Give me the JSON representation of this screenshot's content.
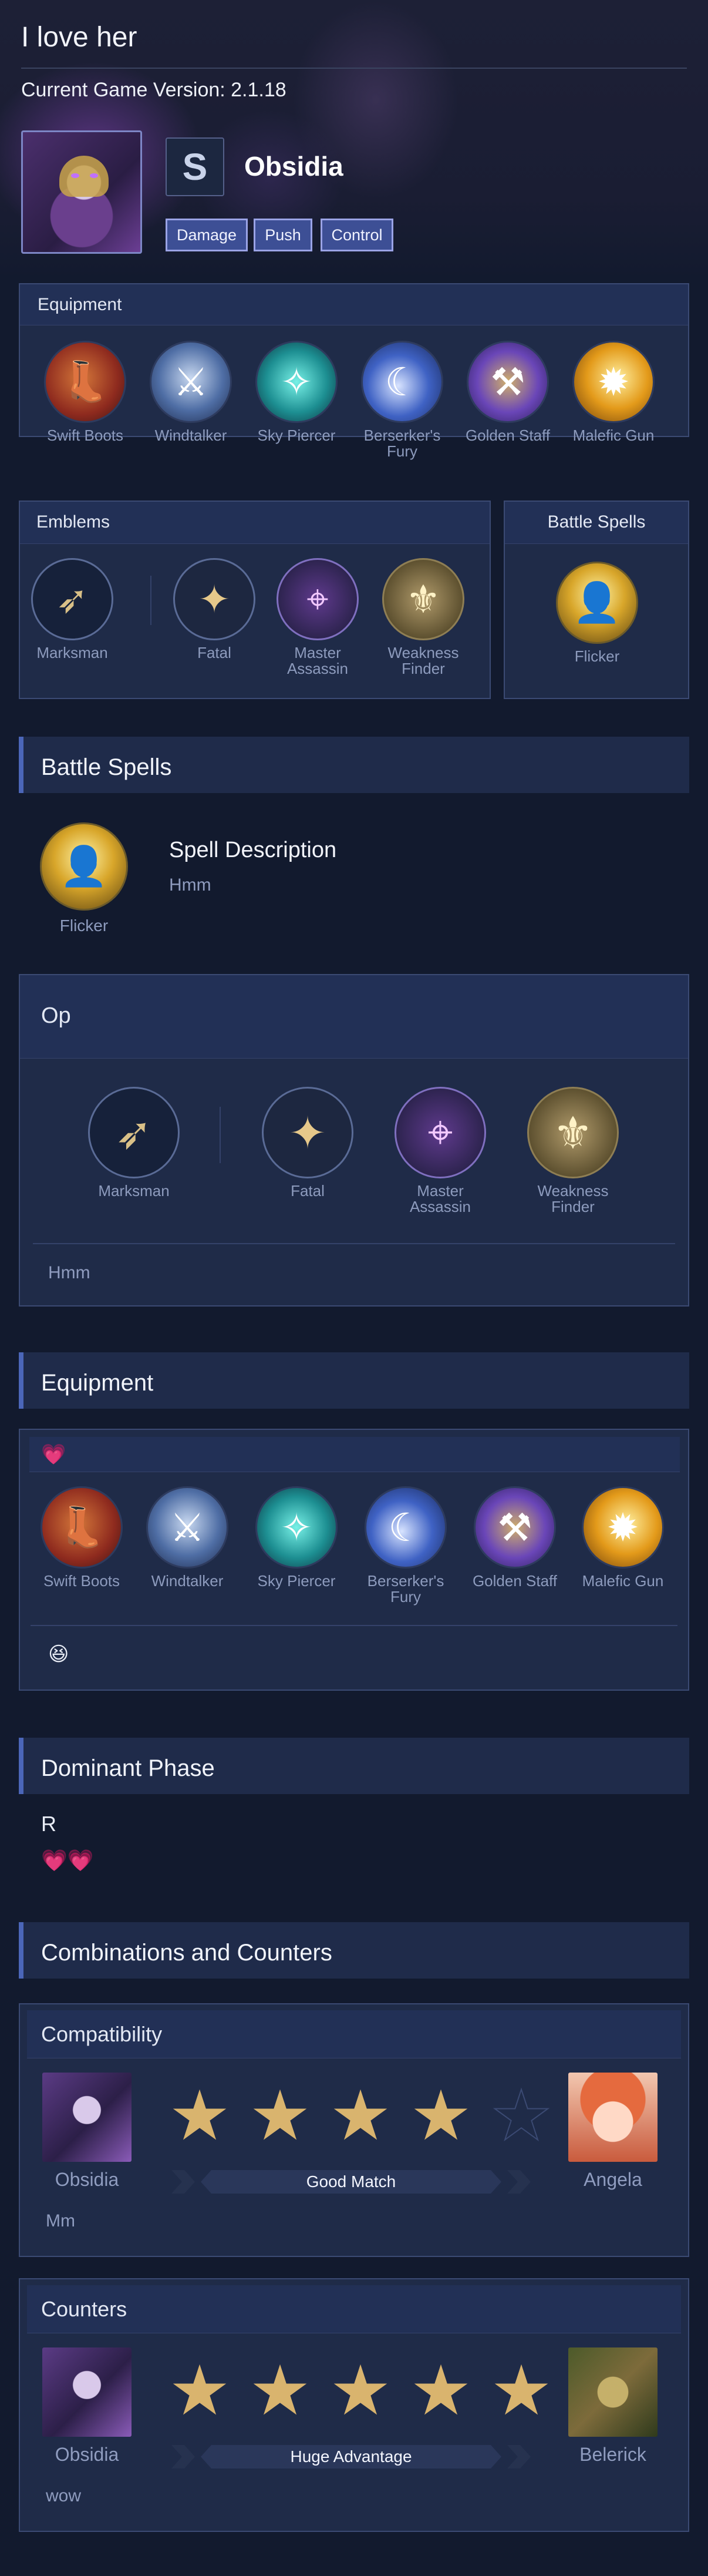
{
  "header": {
    "title": "I love her",
    "version_label": "Current Game Version: 2.1.18",
    "hero_name": "Obsidia",
    "role_icon_glyph": "S",
    "tags": [
      "Damage",
      "Push",
      "Control"
    ]
  },
  "equipment_panel": {
    "title": "Equipment",
    "items": [
      {
        "label": "Swift Boots",
        "icon": "boots-icon"
      },
      {
        "label": "Windtalker",
        "icon": "windtalker-icon"
      },
      {
        "label": "Sky Piercer",
        "icon": "sky-piercer-icon"
      },
      {
        "label": "Berserker's Fury",
        "icon": "berserkers-fury-icon"
      },
      {
        "label": "Golden Staff",
        "icon": "golden-staff-icon"
      },
      {
        "label": "Malefic Gun",
        "icon": "malefic-gun-icon"
      }
    ]
  },
  "emblems_panel": {
    "title": "Emblems",
    "items": [
      {
        "label": "Marksman",
        "icon": "marksman-emblem-icon",
        "glyph": "➶"
      },
      {
        "label": "Fatal",
        "icon": "fatal-talent-icon",
        "glyph": "✦"
      },
      {
        "label": "Master Assassin",
        "icon": "master-assassin-icon",
        "glyph": "⌖"
      },
      {
        "label": "Weakness Finder",
        "icon": "weakness-finder-icon",
        "glyph": "⚜"
      }
    ]
  },
  "battle_spells_panel": {
    "title": "Battle Spells",
    "spell": {
      "label": "Flicker",
      "icon": "flicker-icon"
    }
  },
  "battle_spells_section": {
    "heading": "Battle Spells",
    "spell_label": "Flicker",
    "description_title": "Spell Description",
    "description_text": "Hmm"
  },
  "emblem_build": {
    "title": "Op",
    "items": [
      {
        "label": "Marksman",
        "glyph": "➶"
      },
      {
        "label": "Fatal",
        "glyph": "✦"
      },
      {
        "label": "Master Assassin",
        "glyph": "⌖"
      },
      {
        "label": "Weakness Finder",
        "glyph": "⚜"
      }
    ],
    "note": "Hmm"
  },
  "equipment_section": {
    "heading": "Equipment",
    "title_emoji": "💗",
    "items": [
      "Swift Boots",
      "Windtalker",
      "Sky Piercer",
      "Berserker's Fury",
      "Golden Staff",
      "Malefic Gun"
    ],
    "note_emoji": "😆"
  },
  "dominant_phase": {
    "heading": "Dominant Phase",
    "text": "R",
    "emoji": "💗💗"
  },
  "combos": {
    "heading": "Combinations and Counters",
    "compatibility": {
      "title": "Compatibility",
      "hero": "Obsidia",
      "partner": "Angela",
      "rating": 4,
      "rating_max": 5,
      "verdict": "Good Match",
      "note": "Mm"
    },
    "counters": {
      "title": "Counters",
      "hero": "Obsidia",
      "opponent": "Belerick",
      "rating": 5,
      "rating_max": 5,
      "verdict": "Huge Advantage",
      "note": "wow"
    }
  },
  "colors": {
    "background": "#121a2e",
    "panel": "#1f2b48",
    "accent": "#4b66b8",
    "star": "#d9b46e",
    "tag": "#3d4f95"
  }
}
